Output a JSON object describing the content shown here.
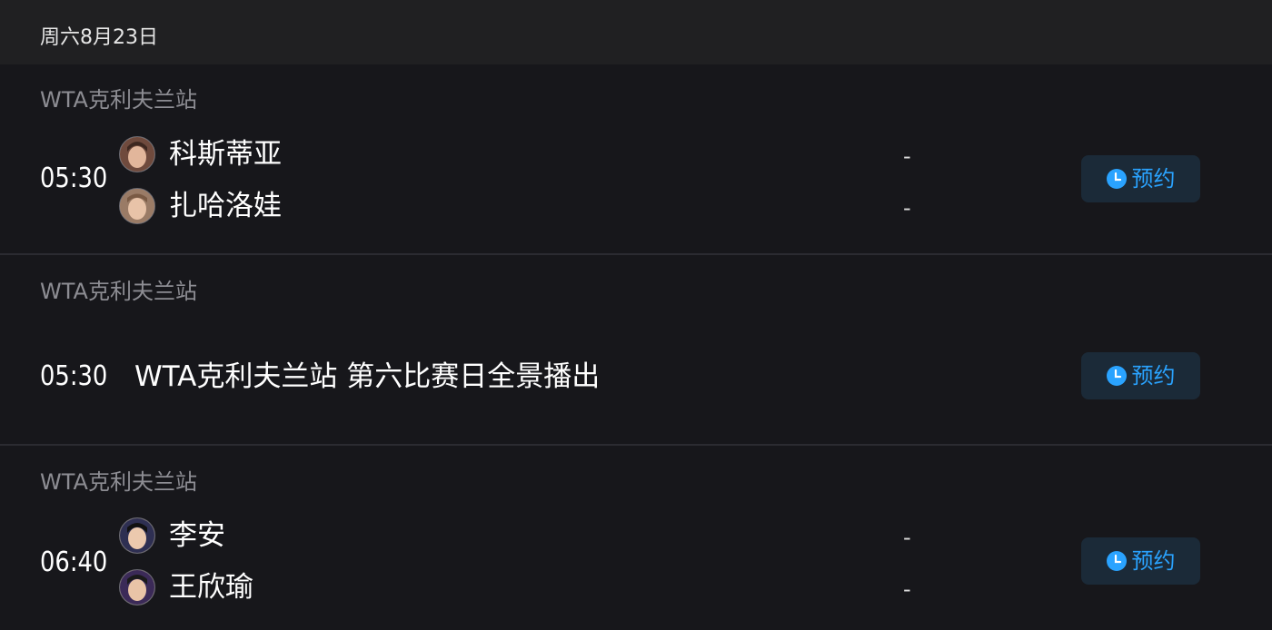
{
  "date_header": "周六8月23日",
  "accent_color": "#2aa3ff",
  "matches": [
    {
      "league": "WTA克利夫兰站",
      "time": "05:30",
      "type": "match",
      "players": [
        {
          "name": "科斯蒂亚",
          "score": "-",
          "avatar": "player-avatar"
        },
        {
          "name": "扎哈洛娃",
          "score": "-",
          "avatar": "player-avatar"
        }
      ],
      "reserve_label": "预约",
      "reserve_icon": "clock-icon"
    },
    {
      "league": "WTA克利夫兰站",
      "time": "05:30",
      "type": "program",
      "title": "WTA克利夫兰站 第六比赛日全景播出",
      "reserve_label": "预约",
      "reserve_icon": "clock-icon"
    },
    {
      "league": "WTA克利夫兰站",
      "time": "06:40",
      "type": "match",
      "players": [
        {
          "name": "李安",
          "score": "-",
          "avatar": "player-avatar"
        },
        {
          "name": "王欣瑜",
          "score": "-",
          "avatar": "player-avatar"
        }
      ],
      "reserve_label": "预约",
      "reserve_icon": "clock-icon"
    }
  ]
}
